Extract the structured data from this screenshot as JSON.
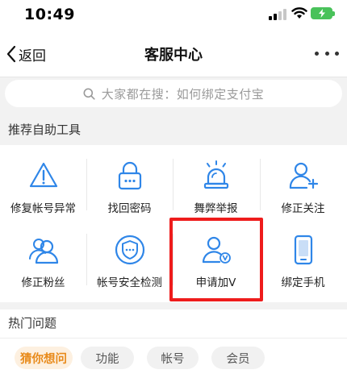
{
  "status_bar": {
    "time": "10:49"
  },
  "nav": {
    "back_label": "返回",
    "title": "客服中心"
  },
  "search": {
    "placeholder": "大家都在搜：如何绑定支付宝"
  },
  "tools_section": {
    "title": "推荐自助工具",
    "items": [
      {
        "label": "修复帐号异常",
        "icon": "warning-icon"
      },
      {
        "label": "找回密码",
        "icon": "lock-icon"
      },
      {
        "label": "舞弊举报",
        "icon": "alarm-light-icon"
      },
      {
        "label": "修正关注",
        "icon": "user-add-icon"
      },
      {
        "label": "修正粉丝",
        "icon": "users-icon"
      },
      {
        "label": "帐号安全检测",
        "icon": "shield-icon"
      },
      {
        "label": "申请加V",
        "icon": "user-verified-icon"
      },
      {
        "label": "绑定手机",
        "icon": "phone-icon"
      }
    ]
  },
  "hot_section": {
    "title": "热门问题",
    "tabs": [
      {
        "label": "猜你想问",
        "active": true
      },
      {
        "label": "功能",
        "active": false
      },
      {
        "label": "帐号",
        "active": false
      },
      {
        "label": "会员",
        "active": false
      }
    ]
  },
  "colors": {
    "icon_blue": "#2f86e8",
    "highlight_red": "#ee1c1c",
    "active_orange": "#e88a1a",
    "battery_green": "#49c25a"
  }
}
